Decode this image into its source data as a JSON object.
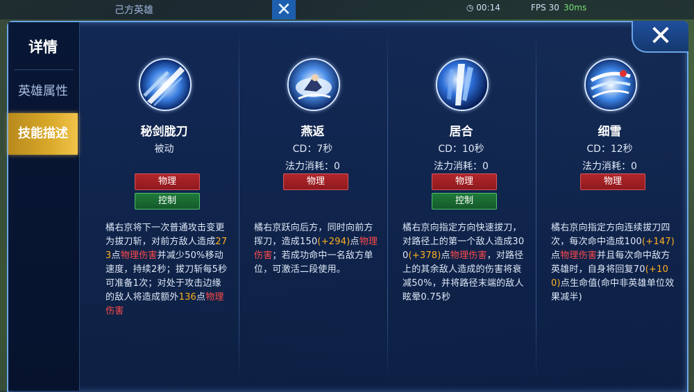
{
  "hud": {
    "team_label": "己方英雄",
    "timer": "00:14",
    "fps": "FPS 30",
    "ping": "30ms"
  },
  "dialog": {
    "sidebar": {
      "title": "详情",
      "tabs": [
        {
          "label": "英雄属性",
          "active": false
        },
        {
          "label": "技能描述",
          "active": true
        }
      ]
    },
    "close_icon": "close-icon",
    "skills": [
      {
        "icon": "sword-slash-icon",
        "name": "秘剑胧刀",
        "line1": "被动",
        "line2": "",
        "badges": [
          "物理",
          "控制"
        ],
        "desc": [
          {
            "t": "橘右京将下一次普通攻击变更为拔刀斩，对前方敌人造成",
            "c": ""
          },
          {
            "t": "273",
            "c": "orange"
          },
          {
            "t": "点",
            "c": ""
          },
          {
            "t": "物理伤害",
            "c": "red"
          },
          {
            "t": "并减少50%移动速度，持续2秒；拔刀斩每5秒可准备1次；对处于攻击边缘的敌人将造成额外",
            "c": ""
          },
          {
            "t": "136",
            "c": "orange"
          },
          {
            "t": "点",
            "c": ""
          },
          {
            "t": "物理伤害",
            "c": "red"
          }
        ]
      },
      {
        "icon": "leap-back-icon",
        "name": "燕返",
        "line1": "CD：7秒",
        "line2": "法力消耗：0",
        "badges": [
          "物理"
        ],
        "desc": [
          {
            "t": "橘右京跃向后方，同时向前方挥刀，造成150",
            "c": ""
          },
          {
            "t": "(+294)",
            "c": "orange"
          },
          {
            "t": "点",
            "c": ""
          },
          {
            "t": "物理伤害",
            "c": "red"
          },
          {
            "t": "；若成功命中一名敌方单位，可激活二段使用。",
            "c": ""
          }
        ]
      },
      {
        "icon": "dash-slash-icon",
        "name": "居合",
        "line1": "CD：10秒",
        "line2": "法力消耗：0",
        "badges": [
          "物理",
          "控制"
        ],
        "desc": [
          {
            "t": "橘右京向指定方向快速拔刀，对路径上的第一个敌人造成300",
            "c": ""
          },
          {
            "t": "(+378)",
            "c": "orange"
          },
          {
            "t": "点",
            "c": ""
          },
          {
            "t": "物理伤害",
            "c": "red"
          },
          {
            "t": "，对路径上的其余敌人造成的伤害将衰减50%，并将路径末端的敌人眩晕0.75秒",
            "c": ""
          }
        ]
      },
      {
        "icon": "multi-slash-icon",
        "name": "细雪",
        "line1": "CD：12秒",
        "line2": "法力消耗：0",
        "badges": [
          "物理"
        ],
        "desc": [
          {
            "t": "橘右京向指定方向连续拔刀四次，每次命中造成100",
            "c": ""
          },
          {
            "t": "(+147)",
            "c": "orange"
          },
          {
            "t": "点",
            "c": ""
          },
          {
            "t": "物理伤害",
            "c": "red"
          },
          {
            "t": "并且每次命中敌方英雄时，自身将回复70",
            "c": ""
          },
          {
            "t": "(+100)",
            "c": "orange"
          },
          {
            "t": "点生命值(命中非英雄单位效果减半)",
            "c": ""
          }
        ]
      }
    ]
  },
  "colors": {
    "physical_badge": "#a02024",
    "control_badge": "#1a6a34",
    "active_tab": "#d9a92a",
    "highlight_number": "#ffb020",
    "highlight_damage": "#ff4a4a"
  }
}
